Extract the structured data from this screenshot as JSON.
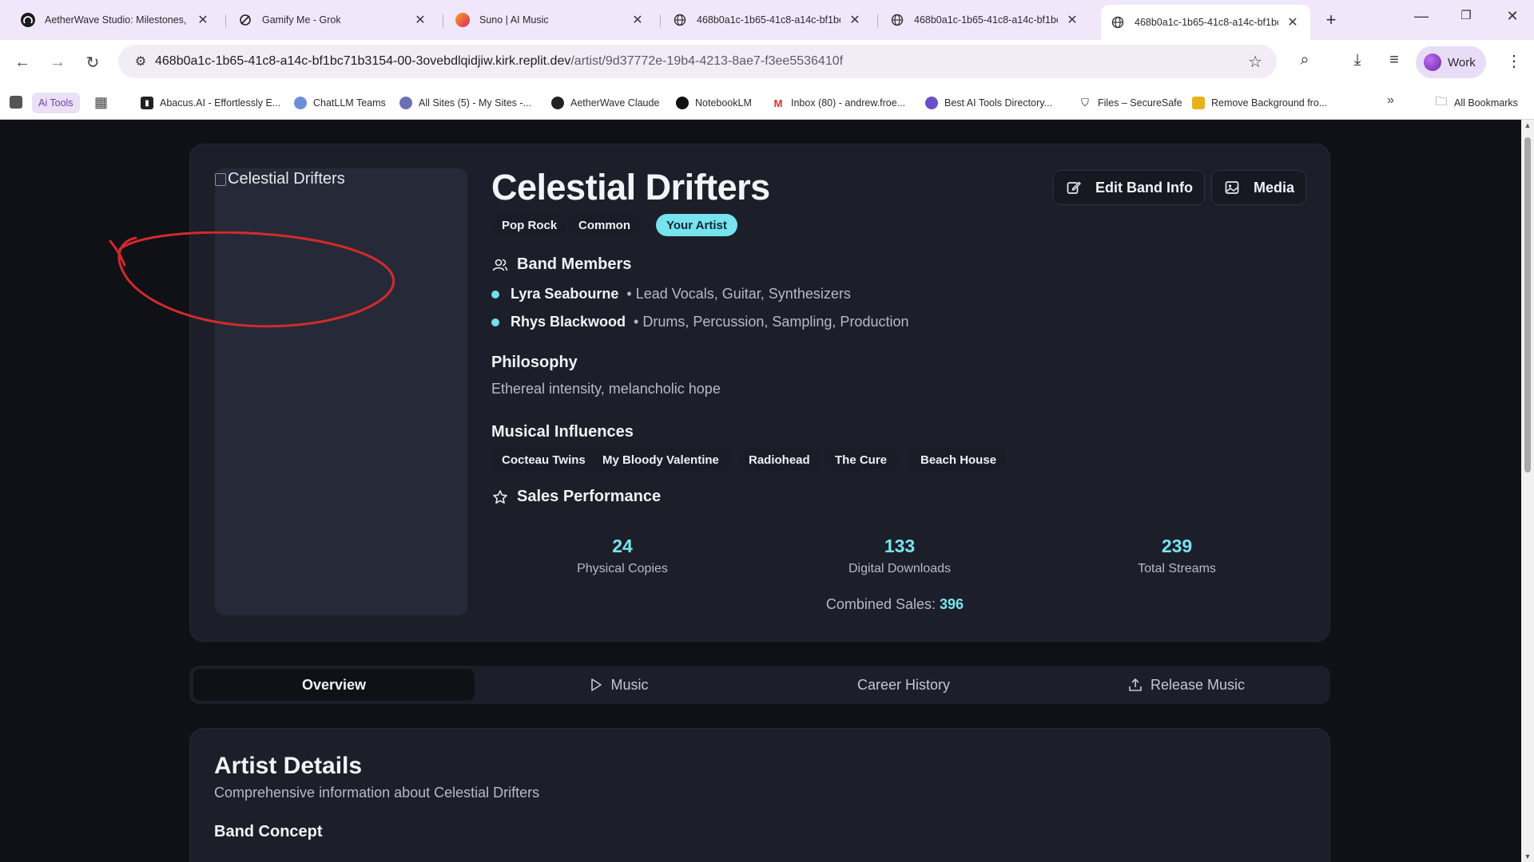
{
  "browser": {
    "tabs": [
      {
        "title": "AetherWave Studio: Milestones, M"
      },
      {
        "title": "Gamify Me - Grok"
      },
      {
        "title": "Suno | AI Music"
      },
      {
        "title": "468b0a1c-1b65-41c8-a14c-bf1bc"
      },
      {
        "title": "468b0a1c-1b65-41c8-a14c-bf1bc"
      },
      {
        "title": "468b0a1c-1b65-41c8-a14c-bf1bc"
      }
    ],
    "url_host": "468b0a1c-1b65-41c8-a14c-bf1bc71b3154-00-3ovebdlqidjiw.kirk.replit.dev",
    "url_path": "/artist/9d37772e-19b4-4213-8ae7-f3ee5536410f",
    "profile": "Work",
    "bookmarks": {
      "ai_tools": "Ai Tools",
      "items": [
        "Abacus.AI - Effortlessly E...",
        "ChatLLM Teams",
        "All Sites (5) - My Sites -...",
        "AetherWave Claude",
        "NotebookLM",
        "Inbox (80) - andrew.froe...",
        "Best AI Tools Directory...",
        "Files – SecureSafe",
        "Remove Background fro..."
      ],
      "all_bookmarks": "All Bookmarks"
    }
  },
  "artist": {
    "cover_alt": "Celestial Drifters",
    "name": "Celestial Drifters",
    "edit_label": "Edit Band Info",
    "media_label": "Media",
    "tags": [
      "Pop Rock",
      "Common",
      "Your Artist"
    ],
    "members_heading": "Band Members",
    "members": [
      {
        "name": "Lyra Seabourne",
        "role": "• Lead Vocals, Guitar, Synthesizers"
      },
      {
        "name": "Rhys Blackwood",
        "role": "• Drums, Percussion, Sampling, Production"
      }
    ],
    "philosophy_heading": "Philosophy",
    "philosophy": "Ethereal intensity, melancholic hope",
    "influences_heading": "Musical Influences",
    "influences": [
      "Cocteau Twins",
      "My Bloody Valentine",
      "Radiohead",
      "The Cure",
      "Beach House"
    ],
    "sales_heading": "Sales Performance",
    "stats": [
      {
        "value": "24",
        "label": "Physical Copies"
      },
      {
        "value": "133",
        "label": "Digital Downloads"
      },
      {
        "value": "239",
        "label": "Total Streams"
      }
    ],
    "combined_label": "Combined Sales:",
    "combined_value": "396"
  },
  "page_tabs": [
    "Overview",
    "Music",
    "Career History",
    "Release Music"
  ],
  "details": {
    "heading": "Artist Details",
    "subtitle": "Comprehensive information about Celestial Drifters",
    "band_concept": "Band Concept"
  },
  "colors": {
    "accent": "#78e4ee",
    "annotation": "#d42a2a",
    "background": "#0f1117"
  }
}
